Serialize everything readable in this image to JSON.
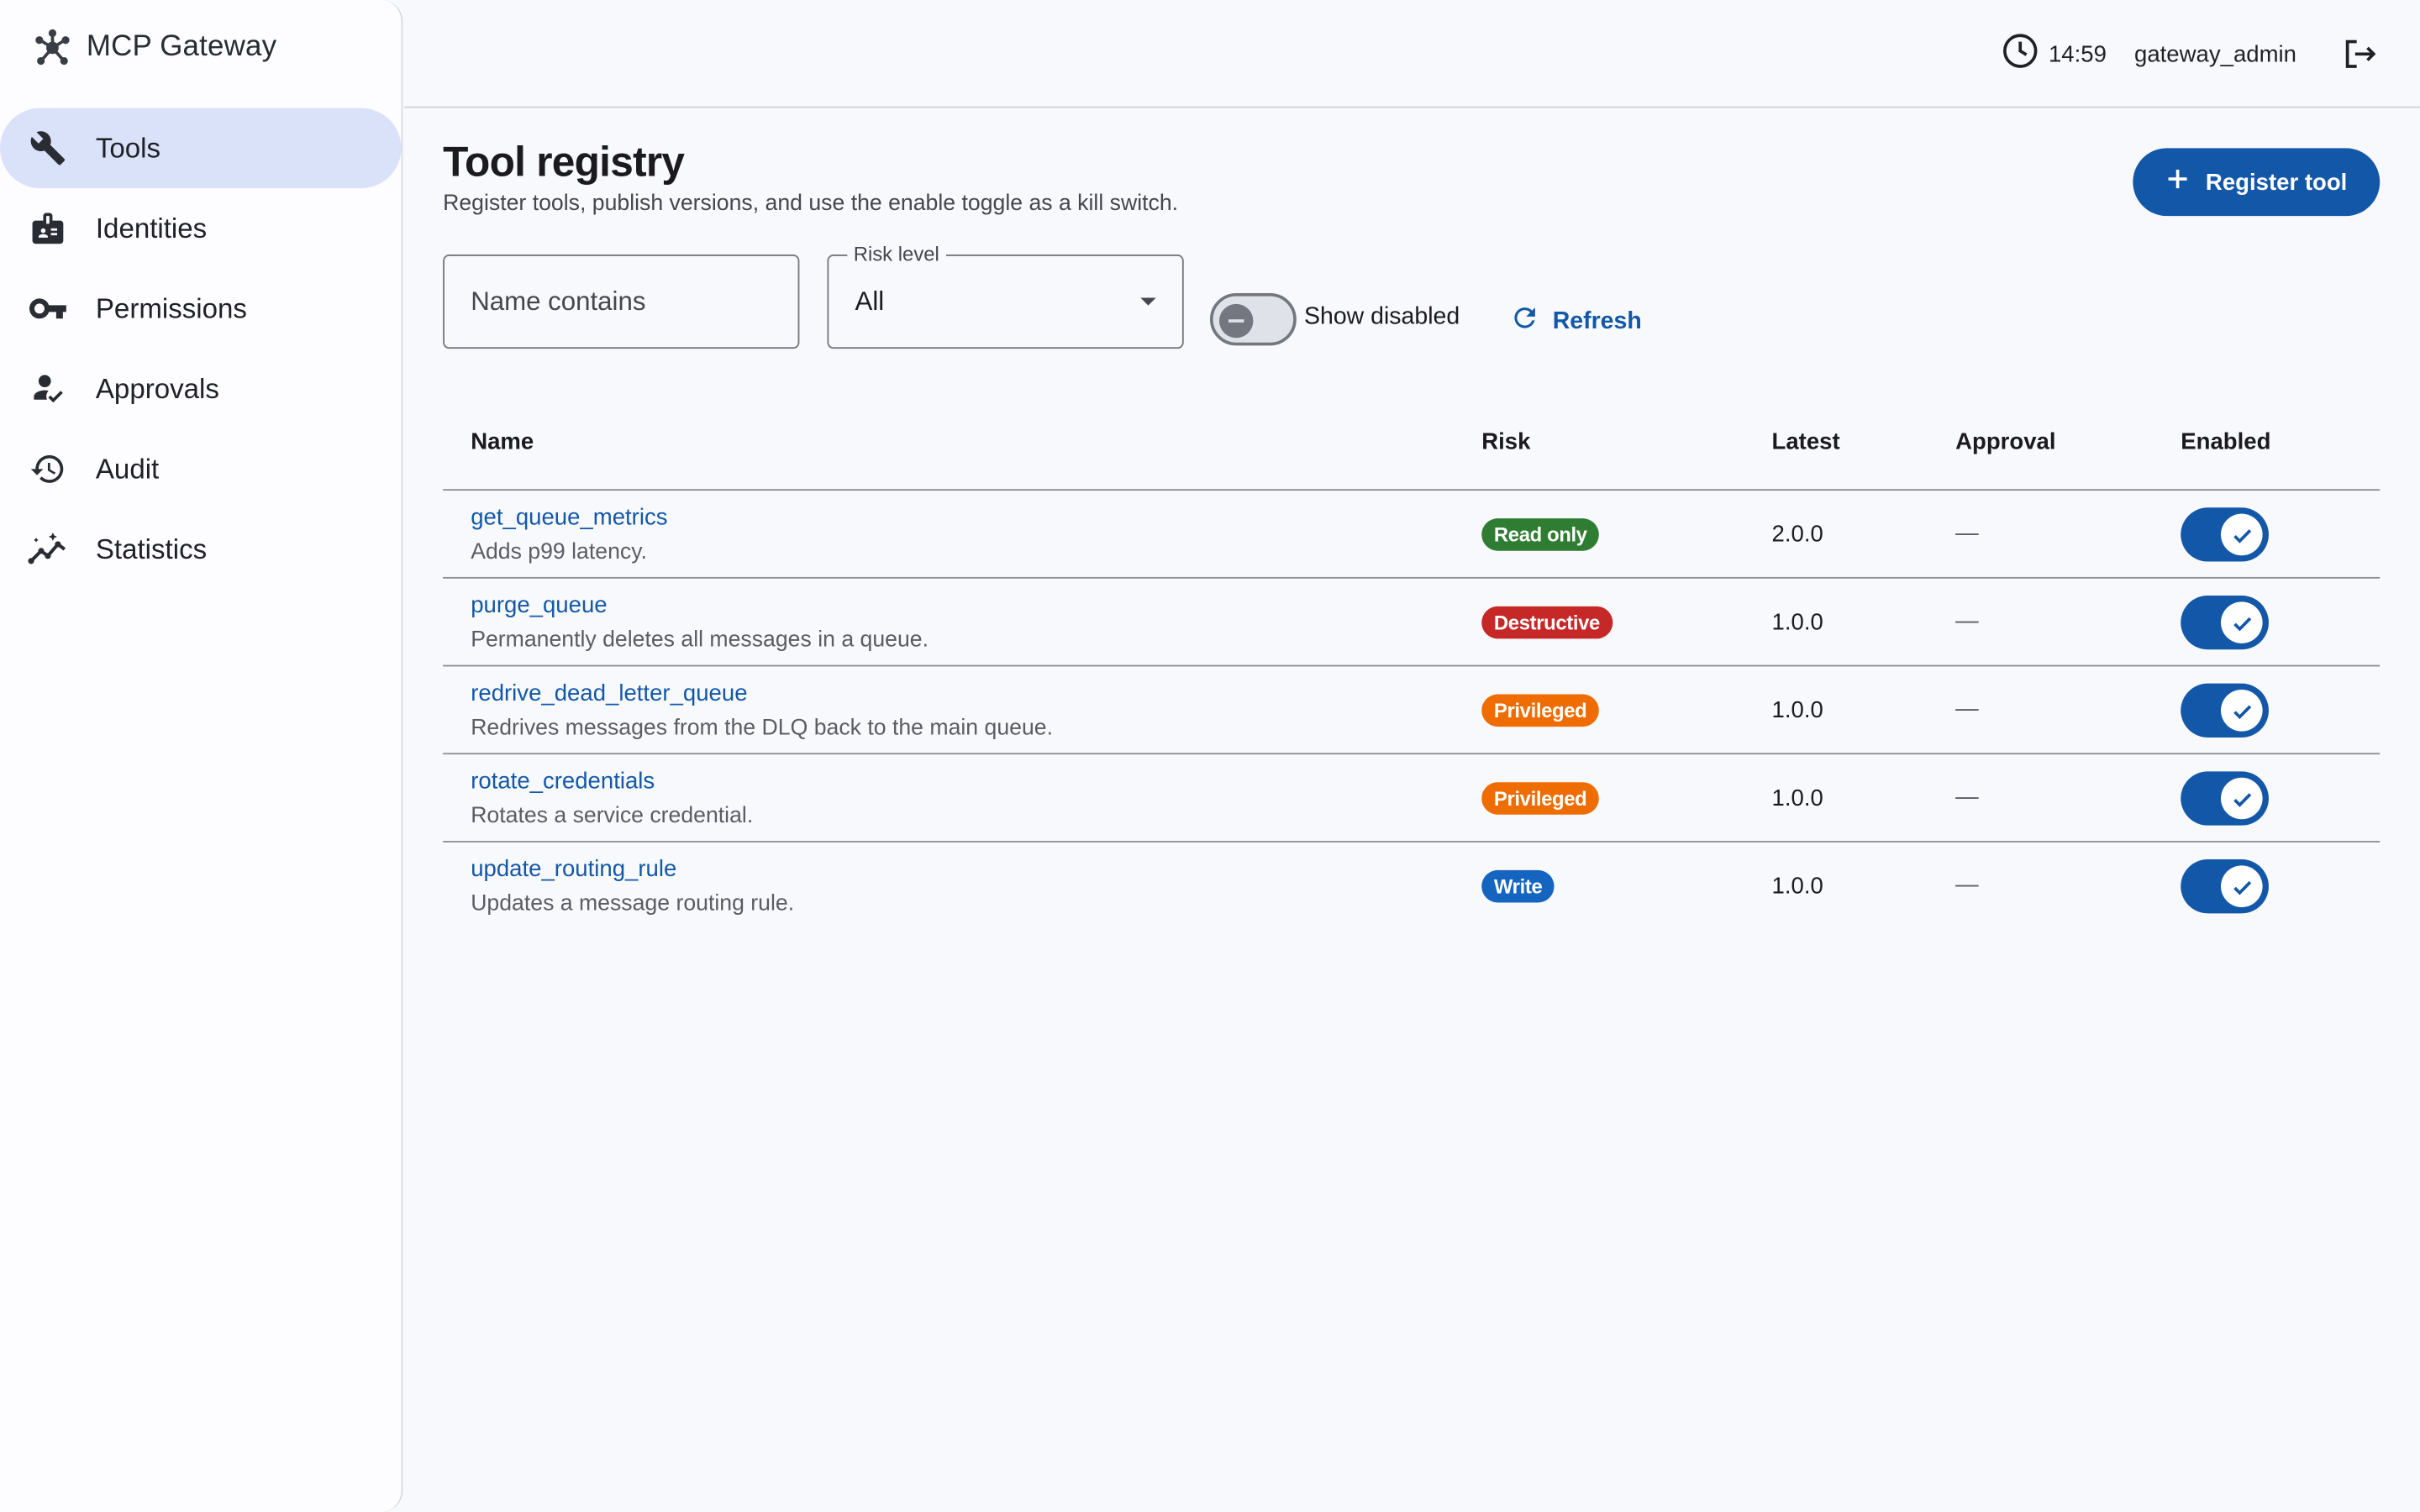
{
  "app": {
    "name": "MCP Gateway"
  },
  "sidebar": {
    "items": [
      {
        "label": "Tools",
        "icon": "wrench-icon",
        "active": true
      },
      {
        "label": "Identities",
        "icon": "badge-icon",
        "active": false
      },
      {
        "label": "Permissions",
        "icon": "key-icon",
        "active": false
      },
      {
        "label": "Approvals",
        "icon": "person-check-icon",
        "active": false
      },
      {
        "label": "Audit",
        "icon": "history-icon",
        "active": false
      },
      {
        "label": "Statistics",
        "icon": "insights-icon",
        "active": false
      }
    ]
  },
  "header": {
    "time": "14:59",
    "user": "gateway_admin"
  },
  "page": {
    "title": "Tool registry",
    "subtitle": "Register tools, publish versions, and use the enable toggle as a kill switch.",
    "register_label": "Register tool"
  },
  "filters": {
    "name_placeholder": "Name contains",
    "name_value": "",
    "risk_label": "Risk level",
    "risk_value": "All",
    "show_disabled_label": "Show disabled",
    "show_disabled_on": false,
    "refresh_label": "Refresh"
  },
  "table": {
    "headers": {
      "name": "Name",
      "risk": "Risk",
      "latest": "Latest",
      "approval": "Approval",
      "enabled": "Enabled"
    },
    "rows": [
      {
        "name": "get_queue_metrics",
        "description": "Adds p99 latency.",
        "risk": "Read only",
        "risk_color": "#2e7d32",
        "latest": "2.0.0",
        "approval": "—",
        "enabled": true
      },
      {
        "name": "purge_queue",
        "description": "Permanently deletes all messages in a queue.",
        "risk": "Destructive",
        "risk_color": "#c62828",
        "latest": "1.0.0",
        "approval": "—",
        "enabled": true
      },
      {
        "name": "redrive_dead_letter_queue",
        "description": "Redrives messages from the DLQ back to the main queue.",
        "risk": "Privileged",
        "risk_color": "#ef6c00",
        "latest": "1.0.0",
        "approval": "—",
        "enabled": true
      },
      {
        "name": "rotate_credentials",
        "description": "Rotates a service credential.",
        "risk": "Privileged",
        "risk_color": "#ef6c00",
        "latest": "1.0.0",
        "approval": "—",
        "enabled": true
      },
      {
        "name": "update_routing_rule",
        "description": "Updates a message routing rule.",
        "risk": "Write",
        "risk_color": "#1565c0",
        "latest": "1.0.0",
        "approval": "—",
        "enabled": true
      }
    ]
  },
  "colors": {
    "accent": "#1358a8",
    "active_nav": "#d9e2f8"
  }
}
